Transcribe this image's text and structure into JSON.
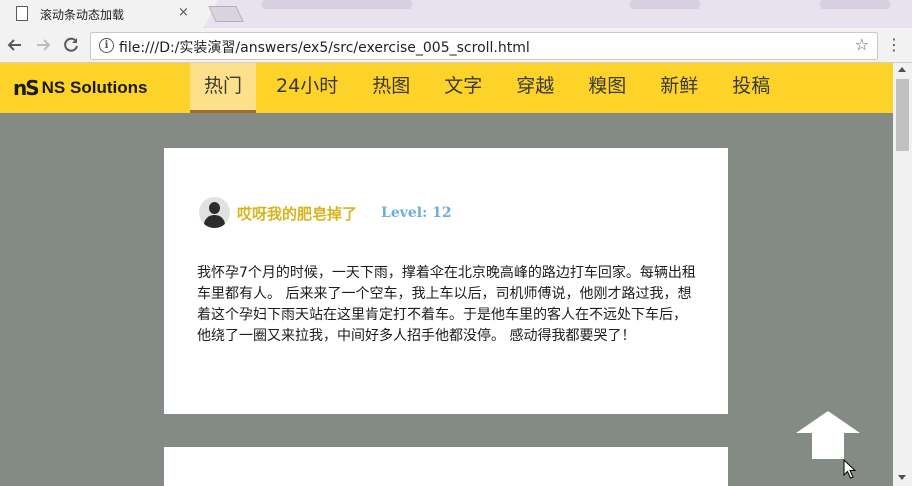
{
  "browser": {
    "tab_title": "滚动条动态加载",
    "tab_close": "×",
    "address": "file:///D:/实装演習/answers/ex5/src/exercise_005_scroll.html",
    "back_icon": "back-arrow-icon",
    "forward_icon": "forward-arrow-icon",
    "reload_icon": "reload-icon",
    "info_icon": "info-icon",
    "star_icon": "star-icon",
    "menu_icon": "menu-dots-icon"
  },
  "header": {
    "logo_mark": "nS",
    "logo_text": "NS Solutions",
    "nav": [
      {
        "label": "热门",
        "active": true
      },
      {
        "label": "24小时"
      },
      {
        "label": "热图"
      },
      {
        "label": "文字"
      },
      {
        "label": "穿越"
      },
      {
        "label": "糗图"
      },
      {
        "label": "新鲜"
      },
      {
        "label": "投稿"
      }
    ]
  },
  "posts": [
    {
      "username": "哎呀我的肥皂掉了",
      "level": "Level: 12",
      "content": "我怀孕7个月的时候，一天下雨，撑着伞在北京晚高峰的路边打车回家。每辆出租车里都有人。 后来来了一个空车，我上车以后，司机师傅说，他刚才路过我，想着这个孕妇下雨天站在这里肯定打不着车。于是他车里的客人在不远处下车后，他绕了一圈又来拉我，中间好多人招手他都没停。 感动得我都要哭了！"
    }
  ],
  "colors": {
    "header_bg": "#fdd329",
    "page_bg": "#848a84",
    "username": "#d7b51d",
    "level": "#6aaedb"
  }
}
